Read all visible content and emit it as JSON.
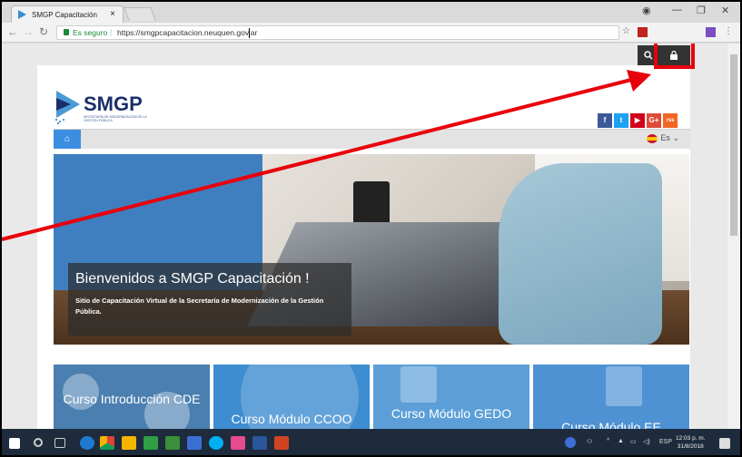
{
  "browser": {
    "tab_title": "SMGP Capacitación",
    "tab_close": "×",
    "secure_label": "Es seguro",
    "url": "https://smgpcapacitacion.neuquen.gov.ar",
    "star": "☆"
  },
  "site": {
    "logo_text": "SMGP",
    "logo_sub": "SECRETARÍA DE MODERNIZACIÓN DE LA GESTIÓN PÚBLICA",
    "social": [
      "f",
      "t",
      "▶",
      "G+",
      "rss"
    ],
    "language": "Es",
    "hero": {
      "title": "Bienvenidos a SMGP Capacitación !",
      "description": "Sitio de Capacitación Virtual de la Secretaría de Modernización de la Gestión Pública."
    },
    "courses": [
      {
        "label": "Curso Introducción CDE",
        "color": "#4a7fb0"
      },
      {
        "label": "Curso Módulo CCOO",
        "color": "#3e8dd0"
      },
      {
        "label": "Curso Módulo GEDO",
        "color": "#5c9fd8"
      },
      {
        "label": "Curso Módulo EE",
        "color": "#4e92d4"
      }
    ]
  },
  "taskbar": {
    "tray_lang": "ESP",
    "time": "12:03 p. m.",
    "date": "31/8/2018"
  },
  "colors": {
    "highlight": "#e8000b",
    "brand_blue": "#1b2f6b",
    "nav_blue": "#3c8ee0"
  }
}
